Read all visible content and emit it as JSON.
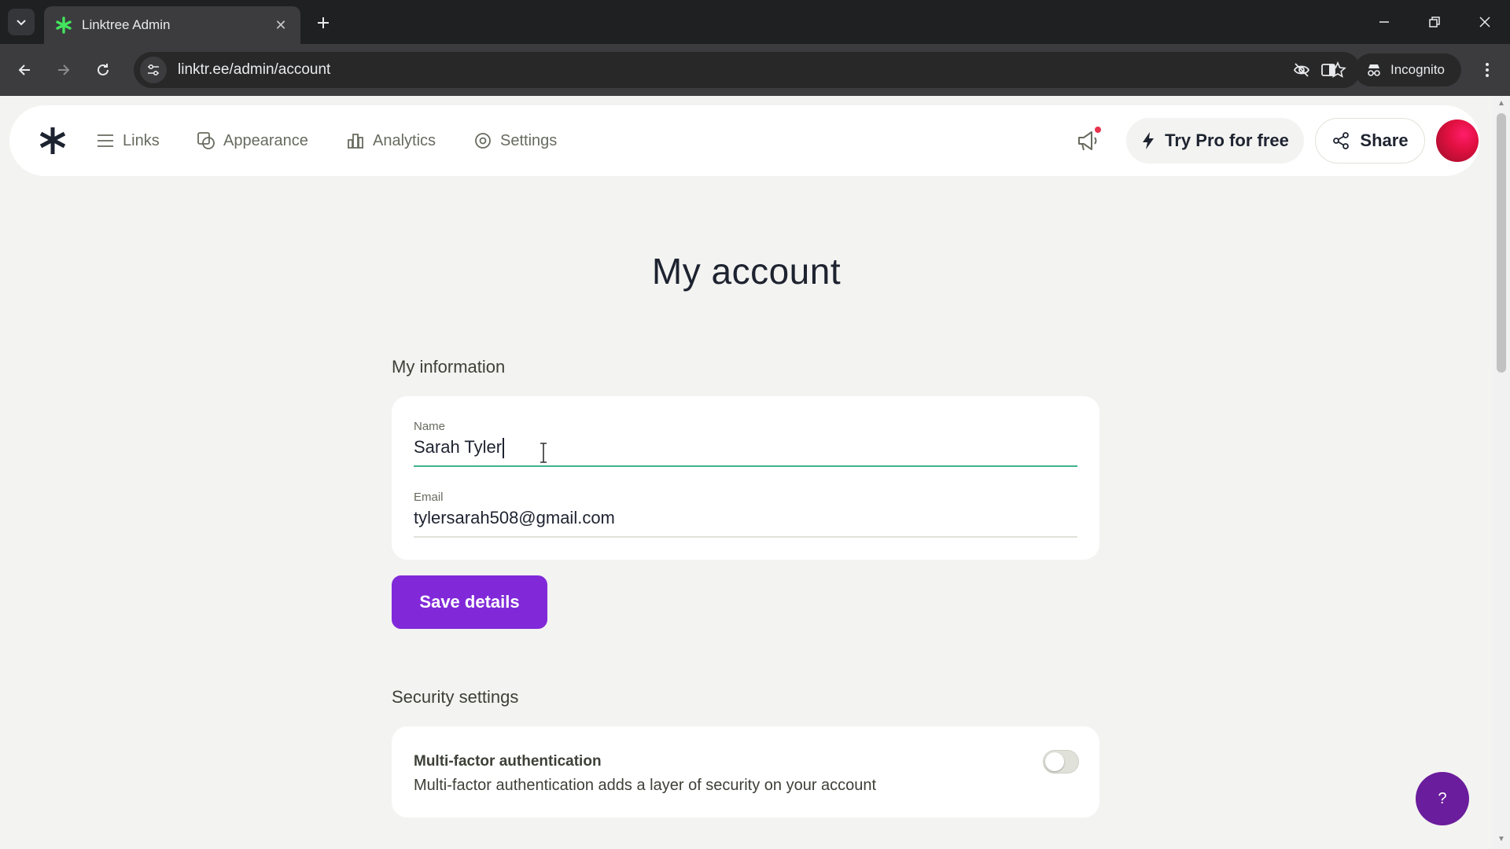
{
  "browser": {
    "tab_title": "Linktree Admin",
    "url": "linktr.ee/admin/account",
    "incognito_label": "Incognito"
  },
  "nav": {
    "items": [
      {
        "label": "Links",
        "icon": "links-icon"
      },
      {
        "label": "Appearance",
        "icon": "appearance-icon"
      },
      {
        "label": "Analytics",
        "icon": "analytics-icon"
      },
      {
        "label": "Settings",
        "icon": "settings-icon"
      }
    ],
    "try_pro_label": "Try Pro for free",
    "share_label": "Share"
  },
  "page": {
    "title": "My account"
  },
  "my_information": {
    "heading": "My information",
    "name_label": "Name",
    "name_value": "Sarah Tyler",
    "email_label": "Email",
    "email_value": "tylersarah508@gmail.com",
    "save_label": "Save details"
  },
  "security": {
    "heading": "Security settings",
    "mfa_title": "Multi-factor authentication",
    "mfa_description": "Multi-factor authentication adds a layer of security on your account",
    "mfa_enabled": false
  },
  "help": {
    "label": "?"
  },
  "colors": {
    "accent_purple": "#8129d9",
    "active_field_line": "#3fb28a",
    "help_button": "#6a1d9c",
    "notification_dot": "#e8344e"
  }
}
